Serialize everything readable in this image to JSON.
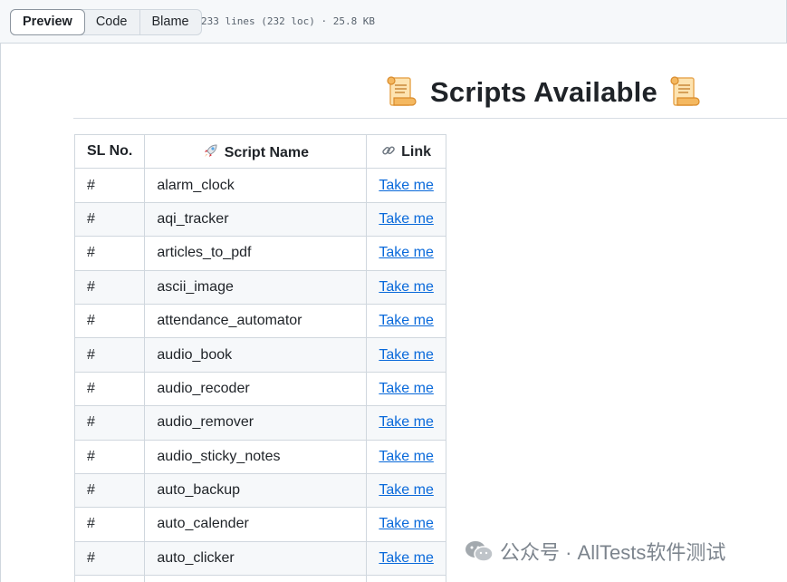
{
  "toolbar": {
    "tabs": [
      {
        "label": "Preview",
        "active": true
      },
      {
        "label": "Code",
        "active": false
      },
      {
        "label": "Blame",
        "active": false
      }
    ],
    "file_info": "233 lines (232 loc) · 25.8 KB"
  },
  "heading": {
    "title": "Scripts Available",
    "icon": "scroll-icon"
  },
  "table": {
    "headers": {
      "sl_no": "SL No.",
      "script_name": "Script Name",
      "script_name_icon": "rocket-icon",
      "link": "Link",
      "link_icon": "link-icon"
    },
    "rows": [
      {
        "sl": "#",
        "name": "alarm_clock",
        "link": "Take me"
      },
      {
        "sl": "#",
        "name": "aqi_tracker",
        "link": "Take me"
      },
      {
        "sl": "#",
        "name": "articles_to_pdf",
        "link": "Take me"
      },
      {
        "sl": "#",
        "name": "ascii_image",
        "link": "Take me"
      },
      {
        "sl": "#",
        "name": "attendance_automator",
        "link": "Take me"
      },
      {
        "sl": "#",
        "name": "audio_book",
        "link": "Take me"
      },
      {
        "sl": "#",
        "name": "audio_recoder",
        "link": "Take me"
      },
      {
        "sl": "#",
        "name": "audio_remover",
        "link": "Take me"
      },
      {
        "sl": "#",
        "name": "audio_sticky_notes",
        "link": "Take me"
      },
      {
        "sl": "#",
        "name": "auto_backup",
        "link": "Take me"
      },
      {
        "sl": "#",
        "name": "auto_calender",
        "link": "Take me"
      },
      {
        "sl": "#",
        "name": "auto_clicker",
        "link": "Take me"
      }
    ]
  },
  "watermark": {
    "text": "公众号 · AllTests软件测试",
    "icon": "wechat-icon"
  },
  "colors": {
    "link": "#0969da",
    "border": "#d0d7de",
    "toolbar_bg": "#f6f8fa",
    "stripe": "#f6f8fa"
  }
}
